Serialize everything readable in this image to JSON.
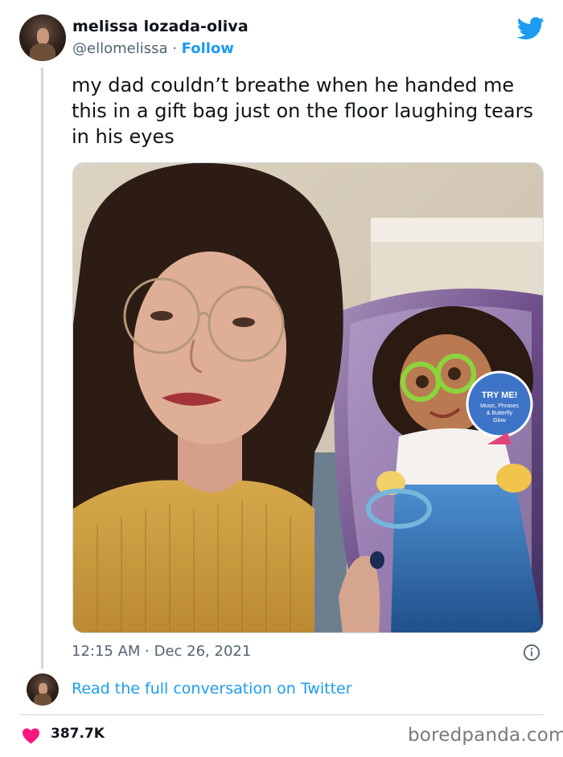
{
  "tweet": {
    "author_name": "melissa lozada-oliva",
    "handle": "@ellomelissa",
    "separator": " · ",
    "follow_label": "Follow",
    "text": "my dad couldn’t breathe when he handed me this in a gift bag just on the floor laughing tears in his eyes",
    "timestamp": "12:15 AM · Dec 26, 2021",
    "read_conversation": "Read the full conversation on Twitter",
    "like_count": "387.7K"
  },
  "photo_packaging": {
    "badge_title": "TRY ME!",
    "badge_line1": "Music, Phrases",
    "badge_line2": "& Butterfly",
    "badge_line3": "Glow"
  },
  "watermark": "boredpanda.com",
  "colors": {
    "accent": "#1d9bf0",
    "like_heart": "#f91880",
    "text_primary": "#0f1419",
    "text_secondary": "#536471",
    "divider": "#cfd9de"
  },
  "icons": {
    "brand": "twitter-bird-icon",
    "info": "info-icon",
    "like": "heart-icon"
  }
}
